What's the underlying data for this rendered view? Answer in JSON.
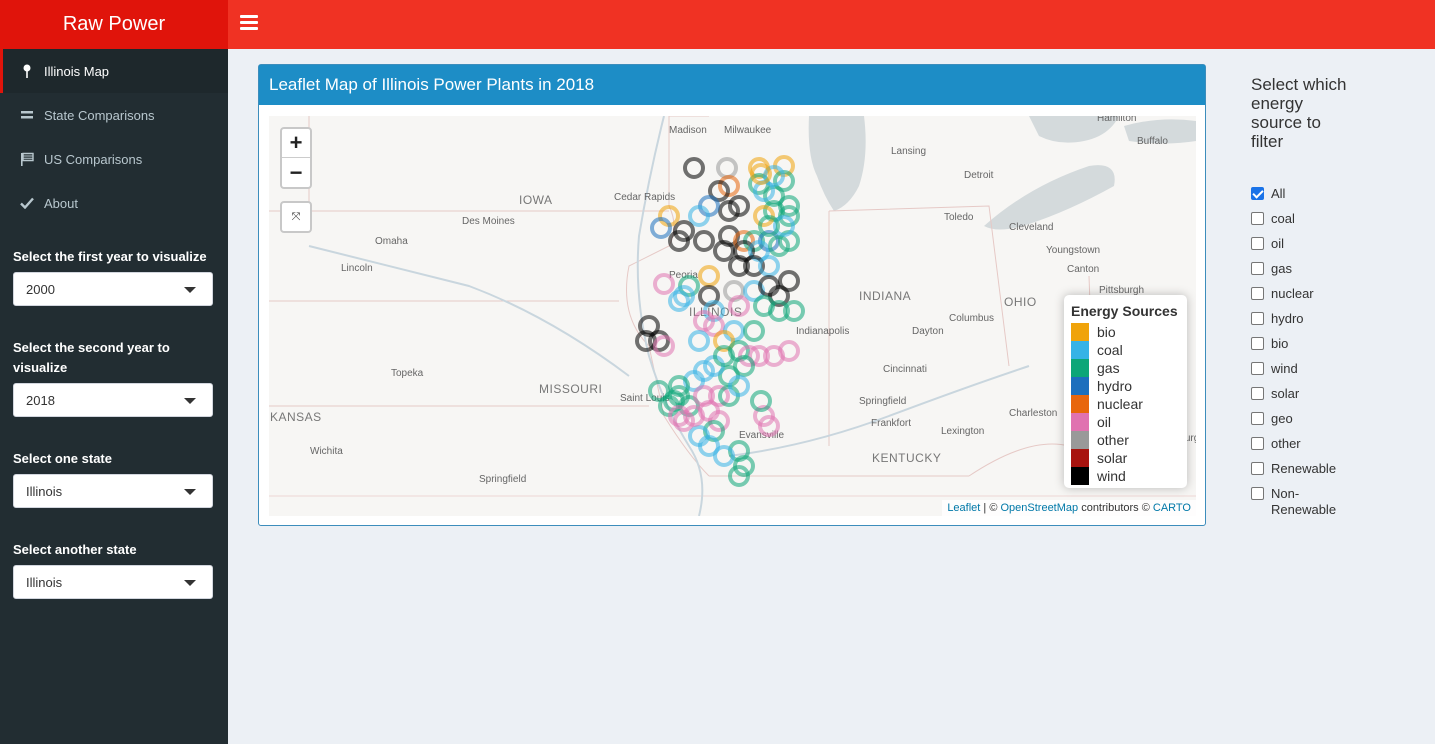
{
  "app": {
    "title": "Raw Power"
  },
  "sidebar": {
    "items": [
      {
        "label": "Illinois Map",
        "icon": "map-marker-icon",
        "active": true
      },
      {
        "label": "State Comparisons",
        "icon": "equals-icon"
      },
      {
        "label": "US Comparisons",
        "icon": "flag-icon"
      },
      {
        "label": "About",
        "icon": "check-icon"
      }
    ],
    "controls": {
      "first_year_label": "Select the first year to visualize",
      "first_year_value": "2000",
      "second_year_label": "Select the second year to visualize",
      "second_year_value": "2018",
      "state1_label": "Select one state",
      "state1_value": "Illinois",
      "state2_label": "Select another state",
      "state2_value": "Illinois"
    }
  },
  "main": {
    "box_title": "Leaflet Map of Illinois Power Plants in 2018",
    "map": {
      "zoom_in": "+",
      "zoom_out": "−",
      "reset": "⤧",
      "place_labels": [
        "Madison",
        "Milwaukee",
        "Hamilton",
        "Buffalo",
        "Lansing",
        "Detroit",
        "IOWA",
        "Cedar Rapids",
        "Des Moines",
        "Toledo",
        "Cleveland",
        "Omaha",
        "Youngstown",
        "Lincoln",
        "Canton",
        "Pittsburgh",
        "Peoria",
        "INDIANA",
        "OHIO",
        "ILLINOIS",
        "Columbus",
        "Springfield",
        "Indianapolis",
        "Dayton",
        "Topeka",
        "Cincinnati",
        "MISSOURI",
        "Saint Louis",
        "KANSAS",
        "Frankfort",
        "Charleston",
        "Evansville",
        "Lexington",
        "Wichita",
        "KENTUCKY",
        "Lynchburg",
        "Springfield"
      ],
      "legend": {
        "title": "Energy Sources",
        "items": [
          {
            "label": "bio",
            "color": "#f0a30a"
          },
          {
            "label": "coal",
            "color": "#36b3e6"
          },
          {
            "label": "gas",
            "color": "#0ca678"
          },
          {
            "label": "hydro",
            "color": "#1c6fbd"
          },
          {
            "label": "nuclear",
            "color": "#e8660c"
          },
          {
            "label": "oil",
            "color": "#e072b0"
          },
          {
            "label": "other",
            "color": "#999999"
          },
          {
            "label": "solar",
            "color": "#a8140f"
          },
          {
            "label": "wind",
            "color": "#000000"
          }
        ]
      },
      "attribution": {
        "leaflet": "Leaflet",
        "sep1": " | © ",
        "osm": "OpenStreetMap",
        "mid": " contributors © ",
        "carto": "CARTO"
      }
    }
  },
  "filter": {
    "title": "Select which energy source to filter",
    "options": [
      {
        "label": "All",
        "checked": true
      },
      {
        "label": "coal",
        "checked": false
      },
      {
        "label": "oil",
        "checked": false
      },
      {
        "label": "gas",
        "checked": false
      },
      {
        "label": "nuclear",
        "checked": false
      },
      {
        "label": "hydro",
        "checked": false
      },
      {
        "label": "bio",
        "checked": false
      },
      {
        "label": "wind",
        "checked": false
      },
      {
        "label": "solar",
        "checked": false
      },
      {
        "label": "geo",
        "checked": false
      },
      {
        "label": "other",
        "checked": false
      },
      {
        "label": "Renewable",
        "checked": false
      },
      {
        "label": "Non-Renewable",
        "checked": false
      }
    ]
  }
}
